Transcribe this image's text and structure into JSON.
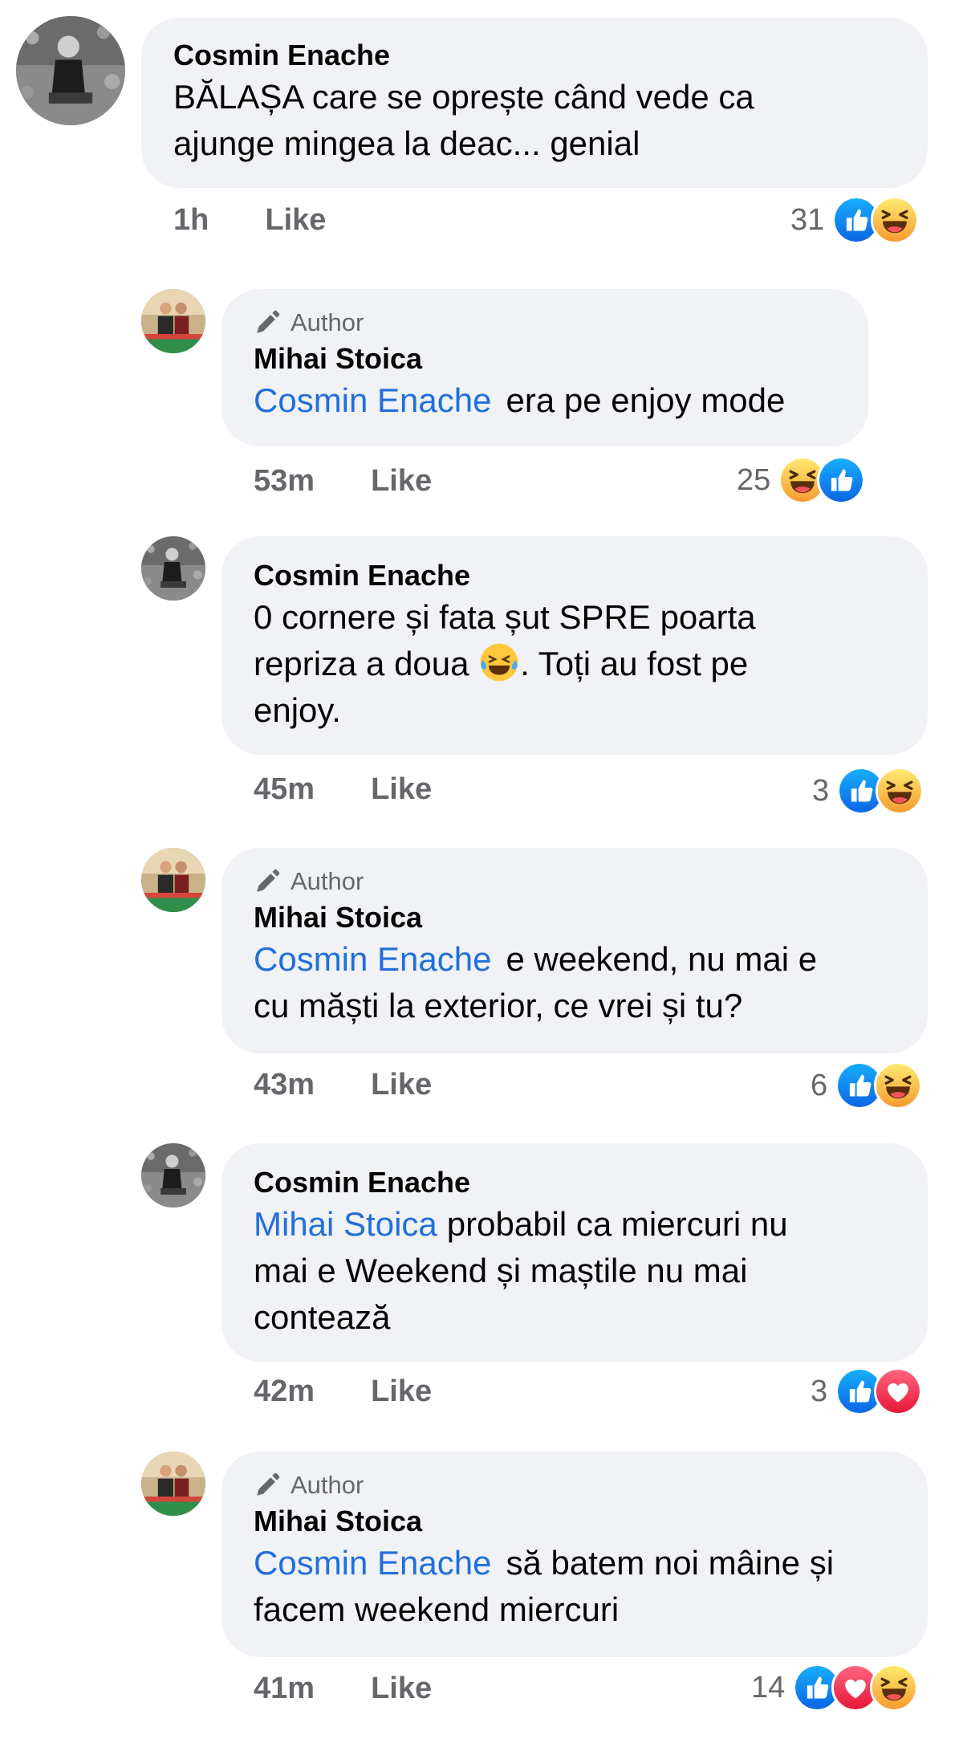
{
  "labels": {
    "author_badge": "Author",
    "like": "Like"
  },
  "comments": [
    {
      "name": "Cosmin Enache",
      "is_author": false,
      "text_lines": [
        "BĂLAȘA care se oprește când vede ca",
        "ajunge mingea la deac... genial"
      ],
      "time": "1h",
      "reaction_count": "31",
      "reactions": [
        "like-icon",
        "haha-icon"
      ]
    },
    {
      "name": "Mihai Stoica",
      "is_author": true,
      "mention": "Cosmin Enache",
      "text_lines": [
        "era pe enjoy mode"
      ],
      "time": "53m",
      "reaction_count": "25",
      "reactions": [
        "haha-icon",
        "like-icon"
      ]
    },
    {
      "name": "Cosmin Enache",
      "is_author": false,
      "text_lines": [
        "0 cornere și fata șut SPRE poarta",
        "repriza a doua",
        ". Toți au fost pe",
        "enjoy."
      ],
      "inline_emoji": "tears-of-joy-emoji",
      "time": "45m",
      "reaction_count": "3",
      "reactions": [
        "like-icon",
        "haha-icon"
      ]
    },
    {
      "name": "Mihai Stoica",
      "is_author": true,
      "mention": "Cosmin Enache",
      "text_lines": [
        "e weekend, nu mai e",
        "cu măști la exterior, ce vrei și tu?"
      ],
      "time": "43m",
      "reaction_count": "6",
      "reactions": [
        "like-icon",
        "haha-icon"
      ]
    },
    {
      "name": "Cosmin Enache",
      "is_author": false,
      "mention": "Mihai Stoica",
      "text_lines": [
        "probabil ca miercuri  nu",
        "mai e Weekend și maștile nu mai",
        "contează"
      ],
      "time": "42m",
      "reaction_count": "3",
      "reactions": [
        "like-icon",
        "love-icon"
      ]
    },
    {
      "name": "Mihai Stoica",
      "is_author": true,
      "mention": "Cosmin Enache",
      "text_lines": [
        "să batem noi mâine și",
        "facem weekend miercuri"
      ],
      "time": "41m",
      "reaction_count": "14",
      "reactions": [
        "like-icon",
        "love-icon",
        "haha-icon"
      ]
    }
  ],
  "colors": {
    "bubble": "#f0f2f5",
    "mention": "#216fdb",
    "meta": "#65676b",
    "like": "#1877f2",
    "love": "#f33e58",
    "haha": "#f7b125"
  }
}
